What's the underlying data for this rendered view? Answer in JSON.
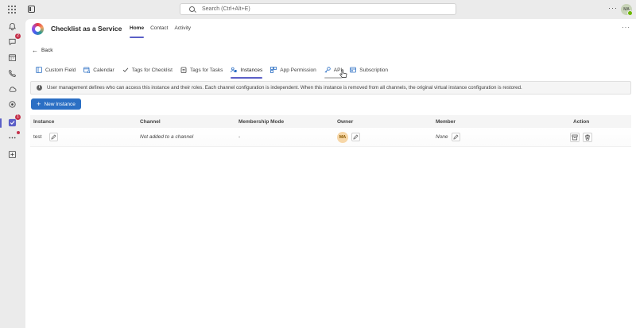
{
  "topbar": {
    "search_placeholder": "Search (Ctrl+Alt+E)",
    "more": "···",
    "avatar_initials": "MA"
  },
  "rail": {
    "items": [
      {
        "icon": "bell-icon",
        "badge": ""
      },
      {
        "icon": "chat-icon",
        "badge": "2"
      },
      {
        "icon": "calendar-icon",
        "badge": ""
      },
      {
        "icon": "phone-icon",
        "badge": ""
      },
      {
        "icon": "cloud-icon",
        "badge": ""
      },
      {
        "icon": "copilot-icon",
        "badge": ""
      },
      {
        "icon": "checklist-app-icon",
        "badge": "1"
      },
      {
        "icon": "more-apps-icon",
        "badge": ""
      },
      {
        "icon": "add-app-icon",
        "badge": ""
      }
    ]
  },
  "app": {
    "title": "Checklist as a Service",
    "nav": [
      "Home",
      "Contact",
      "Activity"
    ],
    "more": "···"
  },
  "back_label": "Back",
  "tabs": [
    {
      "label": "Custom Field",
      "icon": "form-icon"
    },
    {
      "label": "Calendar",
      "icon": "calendar-icon"
    },
    {
      "label": "Tags for Checklist",
      "icon": "check-icon"
    },
    {
      "label": "Tags for Tasks",
      "icon": "clipboard-icon"
    },
    {
      "label": "Instances",
      "icon": "people-icon"
    },
    {
      "label": "App Permission",
      "icon": "app-permission-icon"
    },
    {
      "label": "API",
      "icon": "key-icon"
    },
    {
      "label": "Subscription",
      "icon": "subscription-icon"
    }
  ],
  "active_tab": "Instances",
  "info_text": "User management defines who can access this instance and their roles. Each channel configuration is independent. When this instance is removed from all channels, the original virtual instance configuration is restored.",
  "new_instance_label": "New Instance",
  "table": {
    "headers": [
      "Instance",
      "Channel",
      "Membership Mode",
      "Owner",
      "Member",
      "Action"
    ],
    "rows": [
      {
        "instance": "test",
        "channel": "Not added to a channel",
        "membership_mode": "-",
        "owner_initials": "MA",
        "member": "None"
      }
    ]
  },
  "colors": {
    "accent": "#5b5fc7",
    "primary_button": "#2b6fc4",
    "badge": "#c4314b"
  }
}
